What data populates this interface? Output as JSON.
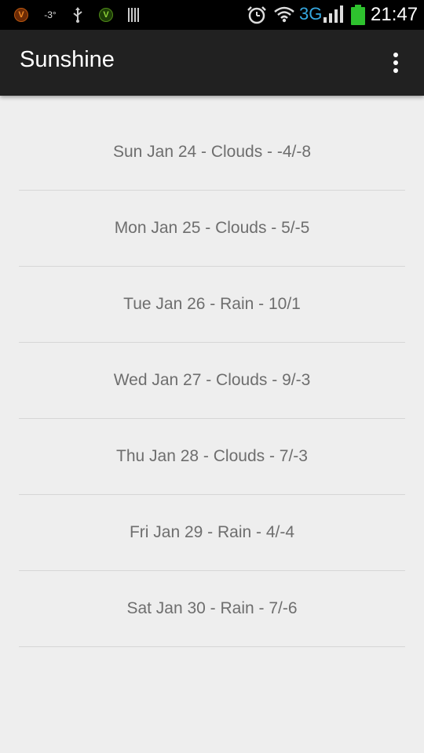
{
  "status_bar": {
    "notifications": [
      {
        "icon": "viber-orange-icon",
        "text": "V"
      },
      {
        "icon": "temperature-icon",
        "text": "-3°"
      },
      {
        "icon": "usb-icon"
      },
      {
        "icon": "viber-green-icon",
        "text": "V"
      },
      {
        "icon": "barcode-icon"
      }
    ],
    "network_type": "3G",
    "time": "21:47",
    "colors": {
      "network": "#35a8e0",
      "battery": "#2ec22e"
    }
  },
  "action_bar": {
    "title": "Sunshine",
    "overflow_icon": "more-vert-icon"
  },
  "forecast": {
    "items": [
      {
        "label": "Sun Jan 24 - Clouds - -4/-8"
      },
      {
        "label": "Mon Jan 25 - Clouds - 5/-5"
      },
      {
        "label": "Tue Jan 26 - Rain - 10/1"
      },
      {
        "label": "Wed Jan 27 - Clouds - 9/-3"
      },
      {
        "label": "Thu Jan 28 - Clouds - 7/-3"
      },
      {
        "label": "Fri Jan 29 - Rain - 4/-4"
      },
      {
        "label": "Sat Jan 30 - Rain - 7/-6"
      }
    ]
  }
}
